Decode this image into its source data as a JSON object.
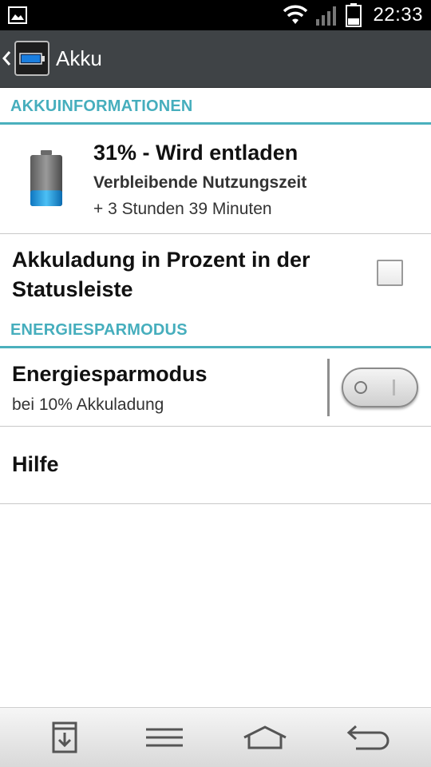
{
  "status_bar": {
    "time": "22:33",
    "icons": [
      "image-notification-icon",
      "wifi-icon",
      "signal-icon",
      "battery-icon"
    ]
  },
  "action_bar": {
    "title": "Akku",
    "app_icon": "battery-app-icon"
  },
  "sections": {
    "battery_info": {
      "header": "AKKUINFORMATIONEN",
      "status": "31% - Wird entladen",
      "remaining_label": "Verbleibende Nutzungszeit",
      "remaining_value": "+ 3 Stunden 39 Minuten",
      "level_percent": 31
    },
    "percent_in_statusbar": {
      "label": "Akkuladung in Prozent in der Statusleiste",
      "checked": false
    },
    "power_saving": {
      "header": "ENERGIESPARMODUS",
      "title": "Energiesparmodus",
      "subtitle": "bei 10% Akkuladung",
      "enabled": false
    },
    "help": {
      "label": "Hilfe"
    }
  },
  "nav_bar": {
    "buttons": [
      "download-icon",
      "menu-icon",
      "home-icon",
      "back-icon"
    ]
  },
  "colors": {
    "accent": "#46aebd",
    "action_bar": "#3f4346",
    "battery_fill": "#1a9be0"
  }
}
